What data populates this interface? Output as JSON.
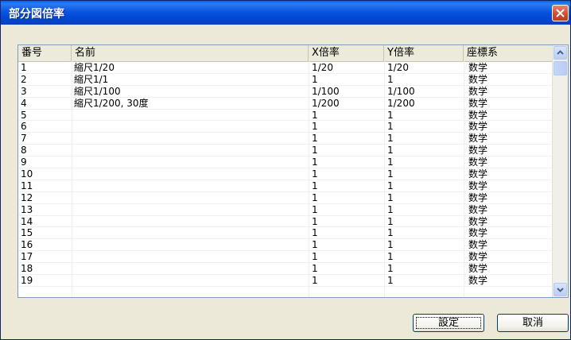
{
  "window": {
    "title": "部分図倍率"
  },
  "columns": [
    "番号",
    "名前",
    "X倍率",
    "Y倍率",
    "座標系"
  ],
  "rows": [
    {
      "no": "1",
      "name": "縮尺1/20",
      "x": "1/20",
      "y": "1/20",
      "coord": "数学"
    },
    {
      "no": "2",
      "name": "縮尺1/1",
      "x": "1",
      "y": "1",
      "coord": "数学"
    },
    {
      "no": "3",
      "name": "縮尺1/100",
      "x": "1/100",
      "y": "1/100",
      "coord": "数学"
    },
    {
      "no": "4",
      "name": "縮尺1/200, 30度",
      "x": "1/200",
      "y": "1/200",
      "coord": "数学"
    },
    {
      "no": "5",
      "name": "",
      "x": "1",
      "y": "1",
      "coord": "数学"
    },
    {
      "no": "6",
      "name": "",
      "x": "1",
      "y": "1",
      "coord": "数学"
    },
    {
      "no": "7",
      "name": "",
      "x": "1",
      "y": "1",
      "coord": "数学"
    },
    {
      "no": "8",
      "name": "",
      "x": "1",
      "y": "1",
      "coord": "数学"
    },
    {
      "no": "9",
      "name": "",
      "x": "1",
      "y": "1",
      "coord": "数学"
    },
    {
      "no": "10",
      "name": "",
      "x": "1",
      "y": "1",
      "coord": "数学"
    },
    {
      "no": "11",
      "name": "",
      "x": "1",
      "y": "1",
      "coord": "数学"
    },
    {
      "no": "12",
      "name": "",
      "x": "1",
      "y": "1",
      "coord": "数学"
    },
    {
      "no": "13",
      "name": "",
      "x": "1",
      "y": "1",
      "coord": "数学"
    },
    {
      "no": "14",
      "name": "",
      "x": "1",
      "y": "1",
      "coord": "数学"
    },
    {
      "no": "15",
      "name": "",
      "x": "1",
      "y": "1",
      "coord": "数学"
    },
    {
      "no": "16",
      "name": "",
      "x": "1",
      "y": "1",
      "coord": "数学"
    },
    {
      "no": "17",
      "name": "",
      "x": "1",
      "y": "1",
      "coord": "数学"
    },
    {
      "no": "18",
      "name": "",
      "x": "1",
      "y": "1",
      "coord": "数学"
    },
    {
      "no": "19",
      "name": "",
      "x": "1",
      "y": "1",
      "coord": "数学"
    }
  ],
  "buttons": {
    "ok": "設定",
    "cancel": "取消"
  },
  "icons": {
    "close": "close-icon",
    "scroll_up": "chevron-up-icon",
    "scroll_down": "chevron-down-icon"
  },
  "colors": {
    "titlebar": "#0b55e0",
    "close": "#d1492e",
    "face": "#ece9d8"
  }
}
